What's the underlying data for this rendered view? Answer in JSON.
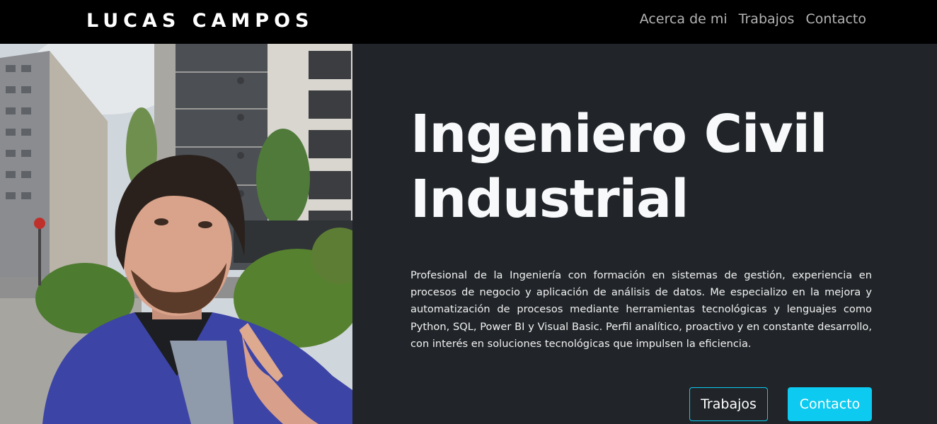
{
  "navbar": {
    "brand": "LUCAS CAMPOS",
    "links": [
      "Acerca de mi",
      "Trabajos",
      "Contacto"
    ]
  },
  "hero": {
    "title_line1": "Ingeniero Civil",
    "title_line2": "Industrial",
    "description": "Profesional de la Ingeniería con formación en sistemas de gestión, experiencia en procesos de negocio y aplicación de análisis de datos. Me especializo en la mejora y automatización de procesos mediante herramientas tecnológicas y lenguajes como Python, SQL, Power BI y Visual Basic. Perfil analítico, proactivo y en constante desarrollo, con interés en soluciones tecnológicas que impulsen la eficiencia.",
    "buttons": {
      "works": "Trabajos",
      "contact": "Contacto"
    }
  },
  "colors": {
    "navbar_bg": "#000000",
    "hero_bg": "#212529",
    "accent": "#0dcaf0"
  },
  "icons": {
    "profile_photo": "profile-photo"
  }
}
